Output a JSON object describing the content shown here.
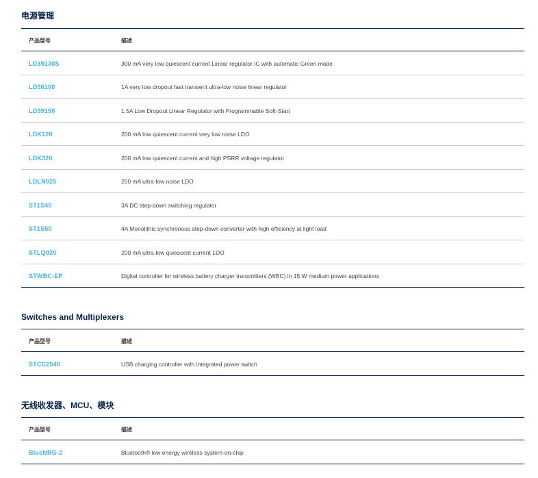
{
  "sections": [
    {
      "title": "电源管理",
      "header": {
        "col1": "产品型号",
        "col2": "描述"
      },
      "rows": [
        {
          "part": "LD39130S",
          "desc": "300 mA very low quiescent current Linear regulator IC with automatic Green mode"
        },
        {
          "part": "LD56100",
          "desc": "1A very low dropout fast transient ultra-low noise linear regulator"
        },
        {
          "part": "LD59150",
          "desc": "1.5A Low Dropout Linear Regulator with Programmable Soft-Start"
        },
        {
          "part": "LDK120",
          "desc": "200 mA low quiescent current very low noise LDO"
        },
        {
          "part": "LDK320",
          "desc": "200 mA low quiescent current and high PSRR voltage regulator"
        },
        {
          "part": "LDLN025",
          "desc": "250 mA ultra-low noise LDO"
        },
        {
          "part": "ST1S40",
          "desc": "3A DC step-down switching regulator"
        },
        {
          "part": "ST1S50",
          "desc": "4A Monolithic synchronous step-down converter with high efficiency at light load"
        },
        {
          "part": "STLQ020",
          "desc": "200 mA ultra-low quiescent current LDO"
        },
        {
          "part": "STWBC-EP",
          "desc": "Digital controller for wireless battery charger transmitters (WBC) in 15 W medium power applications"
        }
      ]
    },
    {
      "title": "Switches and Multiplexers",
      "header": {
        "col1": "产品型号",
        "col2": "描述"
      },
      "rows": [
        {
          "part": "STCC2540",
          "desc": "USB charging controller with integrated power switch"
        }
      ]
    },
    {
      "title": "无线收发器、MCU、模块",
      "header": {
        "col1": "产品型号",
        "col2": "描述"
      },
      "rows": [
        {
          "part": "BlueNRG-2",
          "desc": "Bluetooth® low energy wireless system-on-chip"
        }
      ]
    }
  ],
  "colors": {
    "heading": "#03234b",
    "link": "#3cb4e6",
    "divider": "#c9cdd2"
  }
}
